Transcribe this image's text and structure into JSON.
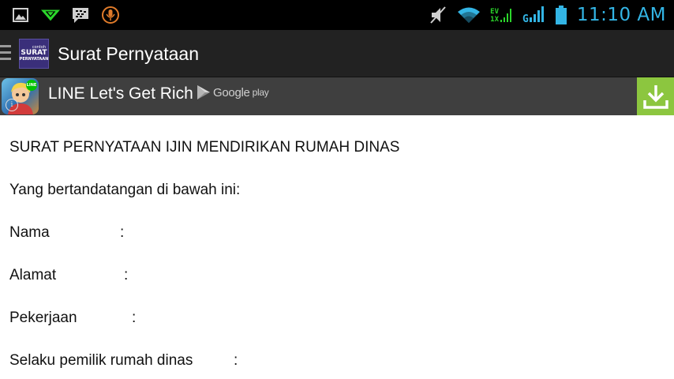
{
  "status_bar": {
    "time": "11:10 AM",
    "network_label_top": "EV",
    "network_label_bottom": "1X",
    "signal_label": "G",
    "icons": [
      "image-icon",
      "message-arrow-icon",
      "bbm-icon",
      "mic-circle-icon",
      "mute-icon",
      "wifi-icon",
      "signal-icon",
      "battery-icon"
    ]
  },
  "action_bar": {
    "title": "Surat Pernyataan",
    "app_icon_lines": [
      "contoh",
      "SURAT",
      "PERNYATAAN"
    ]
  },
  "ad_banner": {
    "title": "LINE Let's Get Rich",
    "store_label": "Google",
    "store_suffix": "play",
    "badge_text": "LINE",
    "accent_color": "#8cc63f"
  },
  "document": {
    "heading": "SURAT PERNYATAAN IJIN MENDIRIKAN RUMAH DINAS",
    "intro": "Yang bertandatangan di bawah ini:",
    "fields": [
      {
        "label": "Nama",
        "colon": ":"
      },
      {
        "label": "Alamat",
        "colon": ":"
      },
      {
        "label": "Pekerjaan",
        "colon": ":"
      },
      {
        "label": "Selaku pemilik rumah dinas",
        "colon": ":"
      }
    ]
  }
}
